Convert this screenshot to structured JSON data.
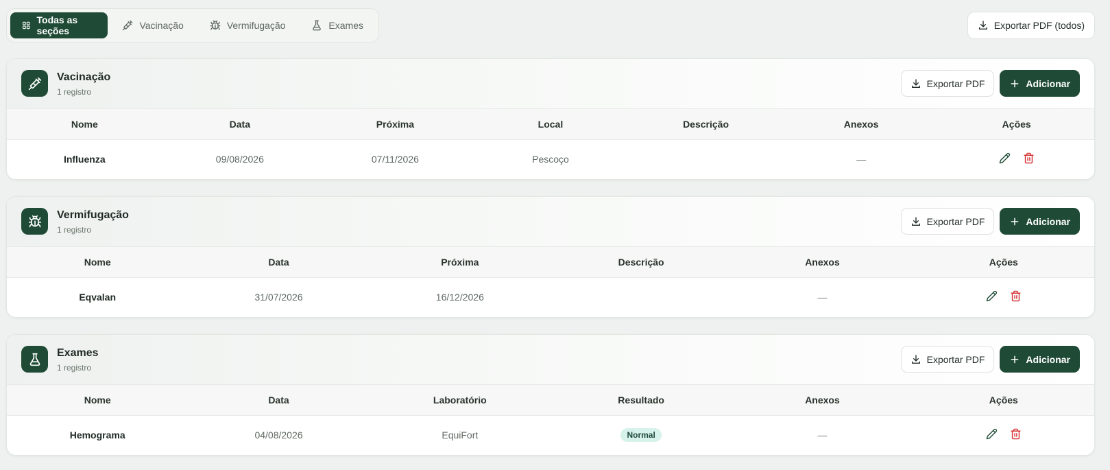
{
  "tabs": [
    {
      "label": "Todas as seções",
      "icon": "grid-icon",
      "active": true
    },
    {
      "label": "Vacinação",
      "icon": "syringe-icon"
    },
    {
      "label": "Vermifugação",
      "icon": "bug-icon"
    },
    {
      "label": "Exames",
      "icon": "flask-icon"
    }
  ],
  "export_all_label": "Exportar PDF (todos)",
  "sections": {
    "vacinacao": {
      "title": "Vacinação",
      "count": "1 registro",
      "export_label": "Exportar PDF",
      "add_label": "Adicionar",
      "columns": [
        "Nome",
        "Data",
        "Próxima",
        "Local",
        "Descrição",
        "Anexos",
        "Ações"
      ],
      "row": {
        "nome": "Influenza",
        "data": "09/08/2026",
        "proxima": "07/11/2026",
        "local": "Pescoço",
        "descricao": "",
        "anexos": "—"
      }
    },
    "vermifugacao": {
      "title": "Vermifugação",
      "count": "1 registro",
      "export_label": "Exportar PDF",
      "add_label": "Adicionar",
      "columns": [
        "Nome",
        "Data",
        "Próxima",
        "Descrição",
        "Anexos",
        "Ações"
      ],
      "row": {
        "nome": "Eqvalan",
        "data": "31/07/2026",
        "proxima": "16/12/2026",
        "descricao": "",
        "anexos": "—"
      }
    },
    "exames": {
      "title": "Exames",
      "count": "1 registro",
      "export_label": "Exportar PDF",
      "add_label": "Adicionar",
      "columns": [
        "Nome",
        "Data",
        "Laboratório",
        "Resultado",
        "Anexos",
        "Ações"
      ],
      "row": {
        "nome": "Hemograma",
        "data": "04/08/2026",
        "laboratorio": "EquiFort",
        "resultado": "Normal",
        "anexos": "—"
      }
    }
  },
  "colors": {
    "primary": "#1f4b36",
    "danger": "#d32f2f",
    "badge_bg": "#d7f2ea"
  }
}
